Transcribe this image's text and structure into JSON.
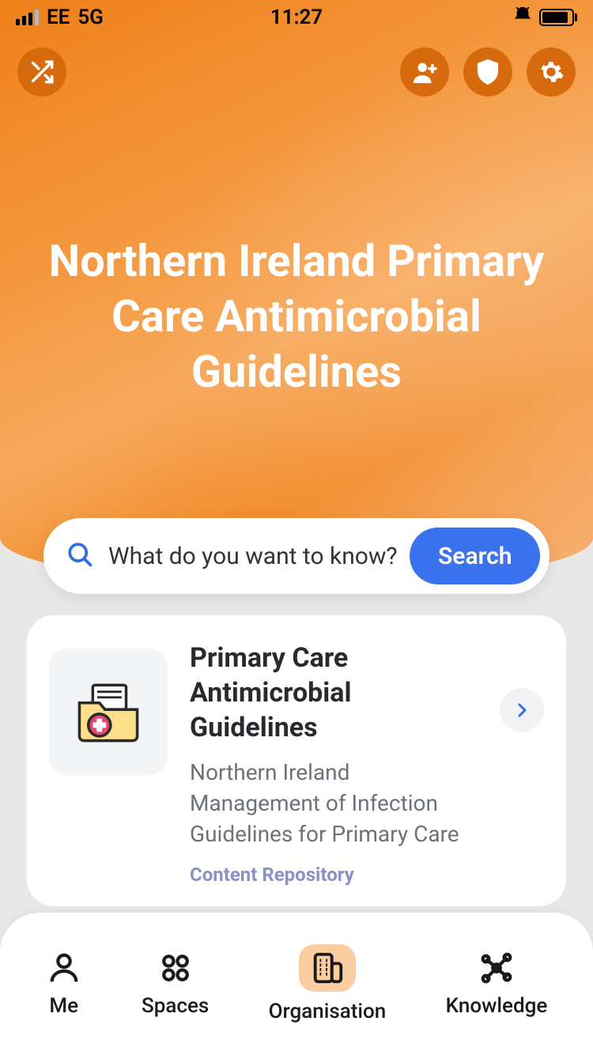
{
  "status": {
    "carrier": "EE",
    "network": "5G",
    "time": "11:27"
  },
  "hero": {
    "title": "Northern Ireland Primary Care Antimicrobial Guidelines"
  },
  "search": {
    "placeholder": "What do you want to know?",
    "button": "Search"
  },
  "card": {
    "title": "Primary Care Antimicrobial Guidelines",
    "subtitle": "Northern Ireland Management of Infection Guidelines for Primary Care",
    "footer": "Content Repository"
  },
  "nav": {
    "me": "Me",
    "spaces": "Spaces",
    "org": "Organisation",
    "knowledge": "Knowledge"
  }
}
